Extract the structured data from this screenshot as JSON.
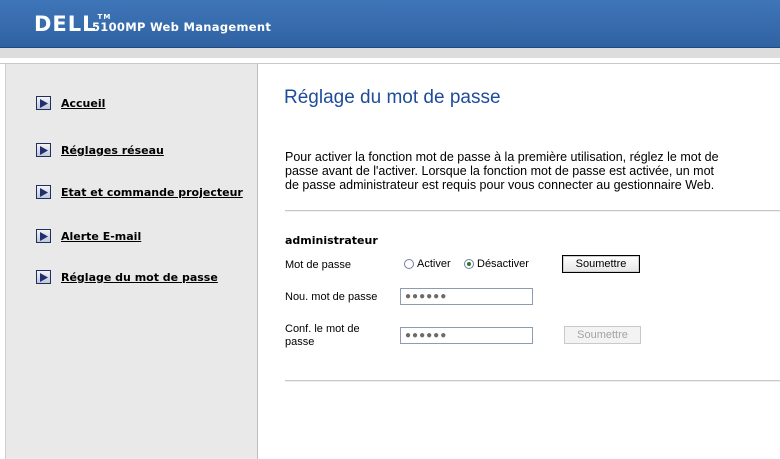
{
  "header": {
    "logo": "DELL",
    "logo_tm": "TM",
    "title": "5100MP Web Management"
  },
  "sidebar": {
    "items": [
      {
        "label": "Accueil"
      },
      {
        "label": "Réglages réseau"
      },
      {
        "label": "Etat et commande projecteur"
      },
      {
        "label": "Alerte E-mail"
      },
      {
        "label": "Réglage du mot de passe"
      }
    ]
  },
  "main": {
    "title": "Réglage du mot de passe",
    "intro_lines": [
      "Pour activer la fonction mot de passe à la première utilisation, réglez le mot de",
      "passe avant de l'activer. Lorsque la fonction mot de passe est activée, un mot",
      "de passe administrateur est requis pour vous connecter au gestionnaire Web."
    ],
    "section": "administrateur",
    "password_label": "Mot de passe",
    "radio_enable": "Activer",
    "radio_disable": "Désactiver",
    "radio_selected": "Désactiver",
    "submit_label": "Soumettre",
    "new_password_label": "Nou. mot de passe",
    "new_password_value": "●●●●●●",
    "confirm_label_line1": "Conf. le mot de",
    "confirm_label_line2": "passe",
    "confirm_password_value": "●●●●●●",
    "submit2_label": "Soumettre"
  },
  "colors": {
    "header_blue": "#3565a8",
    "title_blue": "#1f4b9d",
    "sidebar_bg": "#e9e9e9"
  }
}
